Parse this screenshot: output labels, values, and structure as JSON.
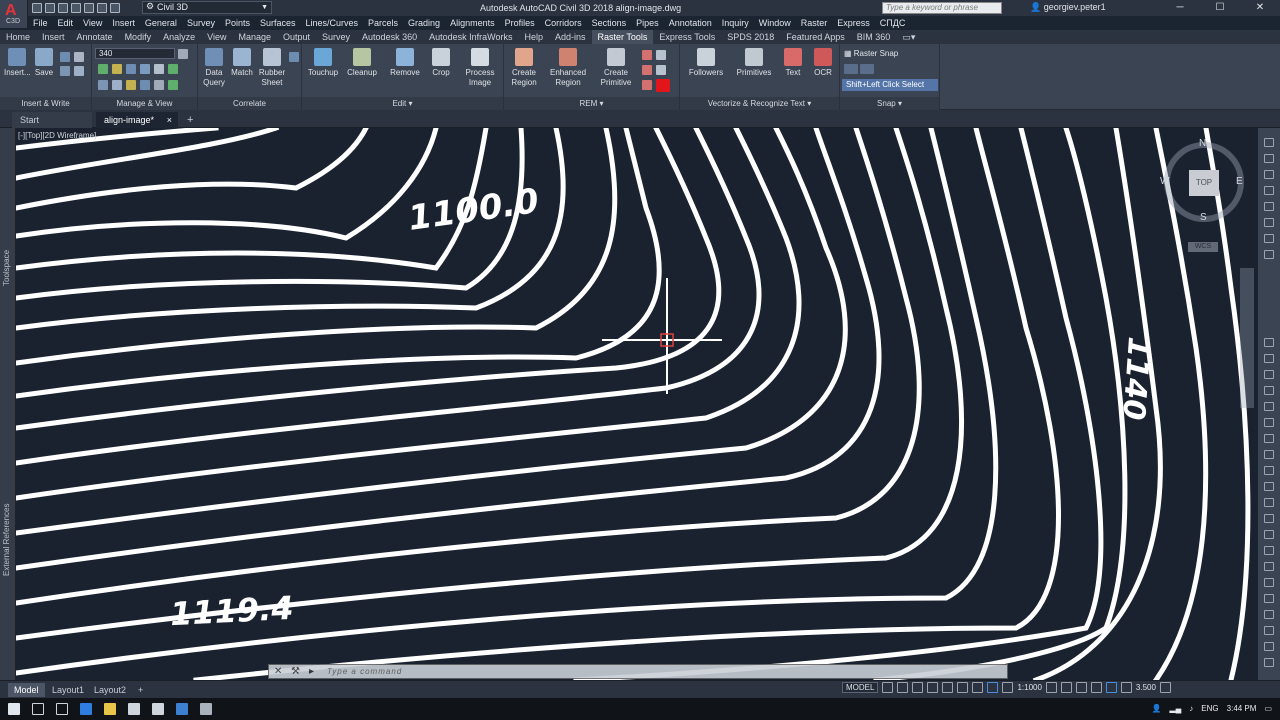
{
  "title_bar": {
    "app_badge": "C3D",
    "workspace": "Civil 3D",
    "title": "Autodesk AutoCAD Civil 3D 2018    align-image.dwg",
    "search_placeholder": "Type a keyword or phrase",
    "user": "georgiev.peter1"
  },
  "menubar": [
    "File",
    "Edit",
    "View",
    "Insert",
    "General",
    "Survey",
    "Points",
    "Surfaces",
    "Lines/Curves",
    "Parcels",
    "Grading",
    "Alignments",
    "Profiles",
    "Corridors",
    "Sections",
    "Pipes",
    "Annotation",
    "Inquiry",
    "Window",
    "Raster",
    "Express",
    "СПДС"
  ],
  "ribbon_tabs": [
    "Home",
    "Insert",
    "Annotate",
    "Modify",
    "Analyze",
    "View",
    "Manage",
    "Output",
    "Survey",
    "Autodesk 360",
    "Autodesk InfraWorks",
    "Help",
    "Add-ins",
    "Raster Tools",
    "Express Tools",
    "SPDS 2018",
    "Featured Apps",
    "BIM 360"
  ],
  "active_ribbon_tab": "Raster Tools",
  "ribbon": {
    "panels": [
      {
        "title": "Insert & Write",
        "tools": [
          "Insert...",
          "Save"
        ]
      },
      {
        "title": "Manage & View",
        "combo": "340"
      },
      {
        "title": "Correlate",
        "tools": [
          "Data Query",
          "Match",
          "Rubber Sheet"
        ]
      },
      {
        "title": "Edit",
        "tools": [
          "Touchup",
          "Cleanup",
          "Remove",
          "Crop",
          "Process Image"
        ]
      },
      {
        "title": "REM",
        "tools": [
          "Create Region",
          "Enhanced Region",
          "Create Primitive"
        ]
      },
      {
        "title": "Vectorize & Recognize Text",
        "tools": [
          "Followers",
          "Primitives",
          "Text",
          "OCR"
        ]
      },
      {
        "title": "Snap",
        "tools": [
          "Raster Snap",
          "Shift+Left Click Select"
        ]
      }
    ]
  },
  "doc_tabs": [
    "Start",
    "align-image*"
  ],
  "viewport_label": "[-][Top][2D Wireframe]",
  "viewcube": {
    "top": "TOP",
    "n": "N",
    "s": "S",
    "e": "E",
    "w": "W",
    "wcs": "WCS"
  },
  "contour_labels": [
    "1100.0",
    "1119.4",
    "1140"
  ],
  "side_labels": {
    "toolspace": "Toolspace",
    "xrefs": "External References"
  },
  "command_placeholder": "Type a command",
  "layout_tabs": [
    "Model",
    "Layout1",
    "Layout2"
  ],
  "status": {
    "mode": "MODEL",
    "scale": "1:1000",
    "value": "3.500"
  },
  "taskbar": {
    "lang": "ENG",
    "time": "3:44 PM"
  }
}
